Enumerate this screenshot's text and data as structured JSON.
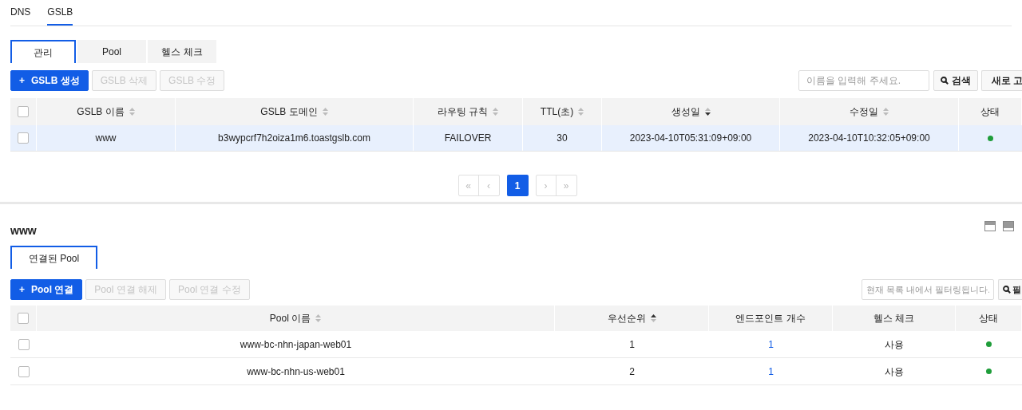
{
  "top_tabs": [
    {
      "label": "DNS",
      "selected": false
    },
    {
      "label": "GSLB",
      "selected": true
    }
  ],
  "sub_tabs": [
    {
      "label": "관리",
      "selected": true
    },
    {
      "label": "Pool",
      "selected": false
    },
    {
      "label": "헬스 체크",
      "selected": false
    }
  ],
  "toolbar": {
    "buttons": [
      {
        "label": "GSLB 생성",
        "icon": "+",
        "disabled": false
      },
      {
        "label": "GSLB 삭제",
        "disabled": true
      },
      {
        "label": "GSLB 수정",
        "disabled": true
      }
    ],
    "search": {
      "placeholder": "이름을 입력해 주세요."
    },
    "search_button": "검색",
    "refresh_button": "새로 고"
  },
  "gslb_table": {
    "columns": [
      {
        "label": "GSLB 이름",
        "sortable": true,
        "sorted_down": false
      },
      {
        "label": "GSLB 도메인",
        "sortable": true,
        "sorted_down": false
      },
      {
        "label": "라우팅 규칙",
        "sortable": true,
        "sorted_down": false
      },
      {
        "label": "TTL(초)",
        "sortable": true,
        "sorted_down": false
      },
      {
        "label": "생성일",
        "sortable": true,
        "sorted_down": true
      },
      {
        "label": "수정일",
        "sortable": true,
        "sorted_down": false
      },
      {
        "label": "상태",
        "sortable": false
      }
    ],
    "header_checked": false,
    "rows": [
      {
        "selected": true,
        "checked": false,
        "cells": [
          "www",
          "b3wypcrf7h2oiza1m6.toastgslb.com",
          "FAILOVER",
          "30",
          "2023-04-10T05:31:09+09:00",
          "2023-04-10T10:32:05+09:00"
        ],
        "color": "#1f9d3a"
      }
    ]
  },
  "pagination": {
    "first": "«",
    "prev": "‹",
    "pages": [
      {
        "label": "1",
        "selected": true
      }
    ],
    "next": "›",
    "last": "»"
  },
  "detail": {
    "title": "www",
    "tabs": [
      {
        "label": "연결된 Pool",
        "selected": true
      }
    ],
    "buttons": [
      {
        "label": "Pool 연결",
        "icon": "+",
        "disabled": false
      },
      {
        "label": "Pool 연결 해제",
        "disabled": true
      },
      {
        "label": "Pool 연결 수정",
        "disabled": true
      }
    ],
    "filter": {
      "placeholder": "현재 목록 내에서 필터링됩니다."
    },
    "filter_button": "필",
    "table": {
      "columns": [
        {
          "label": "Pool 이름",
          "sortable": true,
          "sorted_up": false
        },
        {
          "label": "우선순위",
          "sortable": true,
          "sorted_up": true
        },
        {
          "label": "엔드포인트 개수",
          "sortable": false
        },
        {
          "label": "헬스 체크",
          "sortable": false
        },
        {
          "label": "상태",
          "sortable": false
        }
      ],
      "header_checked": false,
      "rows": [
        {
          "checked": false,
          "cells": [
            "www-bc-nhn-japan-web01",
            "1",
            "1",
            "사용"
          ],
          "color": "#1f9d3a"
        },
        {
          "checked": false,
          "cells": [
            "www-bc-nhn-us-web01",
            "2",
            "1",
            "사용"
          ],
          "color": "#1f9d3a"
        }
      ]
    }
  }
}
